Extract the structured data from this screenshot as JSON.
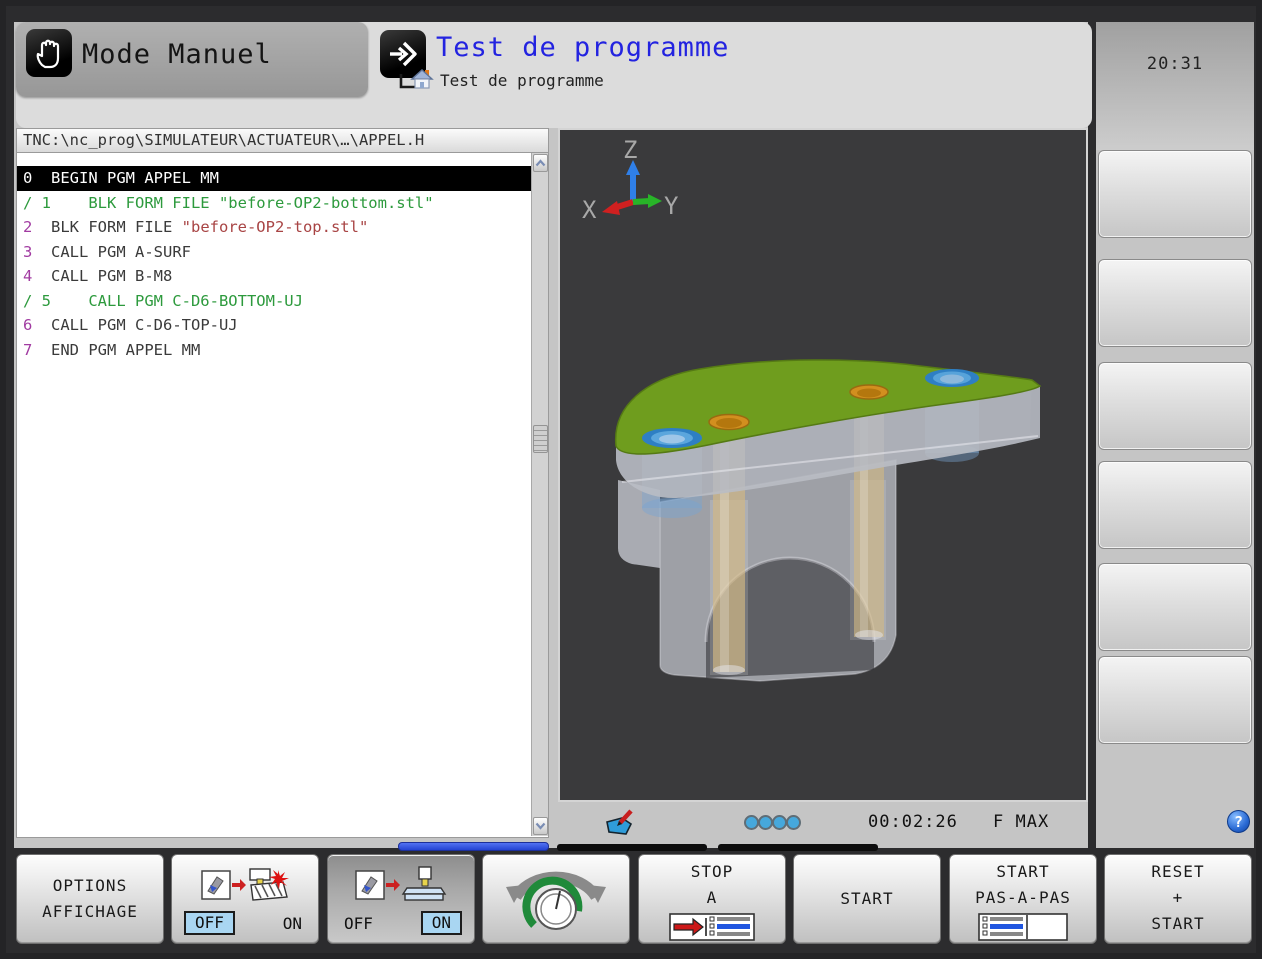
{
  "header": {
    "mode_label": "Mode Manuel",
    "title": "Test de programme",
    "subtitle": "Test de programme",
    "clock": "20:31"
  },
  "program": {
    "path": "TNC:\\nc_prog\\SIMULATEUR\\ACTUATEUR\\…\\APPEL.H",
    "lines": [
      {
        "sel": true,
        "parts": [
          {
            "t": "0  BEGIN PGM APPEL MM",
            "c": "w"
          }
        ]
      },
      {
        "sel": false,
        "parts": [
          {
            "t": "/ 1    BLK FORM FILE \"before-OP2-bottom.stl\"",
            "c": "g"
          }
        ]
      },
      {
        "sel": false,
        "parts": [
          {
            "t": "2",
            "c": "p"
          },
          {
            "t": "  BLK FORM FILE ",
            "c": "d"
          },
          {
            "t": "\"before-OP2-top.stl\"",
            "c": "r"
          }
        ]
      },
      {
        "sel": false,
        "parts": [
          {
            "t": "3",
            "c": "p"
          },
          {
            "t": "  CALL PGM A-SURF",
            "c": "d"
          }
        ]
      },
      {
        "sel": false,
        "parts": [
          {
            "t": "4",
            "c": "p"
          },
          {
            "t": "  CALL PGM B-M8",
            "c": "d"
          }
        ]
      },
      {
        "sel": false,
        "parts": [
          {
            "t": "/ 5    CALL PGM C-D6-BOTTOM-UJ",
            "c": "g"
          }
        ]
      },
      {
        "sel": false,
        "parts": [
          {
            "t": "6",
            "c": "p"
          },
          {
            "t": "  CALL PGM C-D6-TOP-UJ",
            "c": "d"
          }
        ]
      },
      {
        "sel": false,
        "parts": [
          {
            "t": "7",
            "c": "p"
          },
          {
            "t": "  END PGM APPEL MM",
            "c": "d"
          }
        ]
      }
    ]
  },
  "viewport": {
    "axis_x": "X",
    "axis_y": "Y",
    "axis_z": "Z"
  },
  "status": {
    "time": "00:02:26",
    "feed": "F MAX",
    "help": "?",
    "dots": 4
  },
  "softkeys": {
    "k1": [
      "OPTIONS",
      "AFFICHAGE"
    ],
    "k2": {
      "off": "OFF",
      "on": "ON",
      "active": "OFF"
    },
    "k3": {
      "off": "OFF",
      "on": "ON",
      "active": "ON"
    },
    "k5": [
      "STOP",
      "A"
    ],
    "k6": "START",
    "k7": [
      "START",
      "PAS-A-PAS"
    ],
    "k8": [
      "RESET",
      "+",
      "START"
    ]
  },
  "right_softkeys": {
    "count": 6
  },
  "colors": {
    "title_blue": "#2323e0",
    "program_green": "#2d9a3d",
    "program_purple": "#a13ba1",
    "program_red": "#a84444",
    "toggle_blue": "#a9d6f2",
    "scrollbar_blue": "#2f55e8",
    "part_top_green": "#6f9d1e",
    "hole_blue": "#2e7fc4",
    "hole_orange": "#d28f1f"
  }
}
